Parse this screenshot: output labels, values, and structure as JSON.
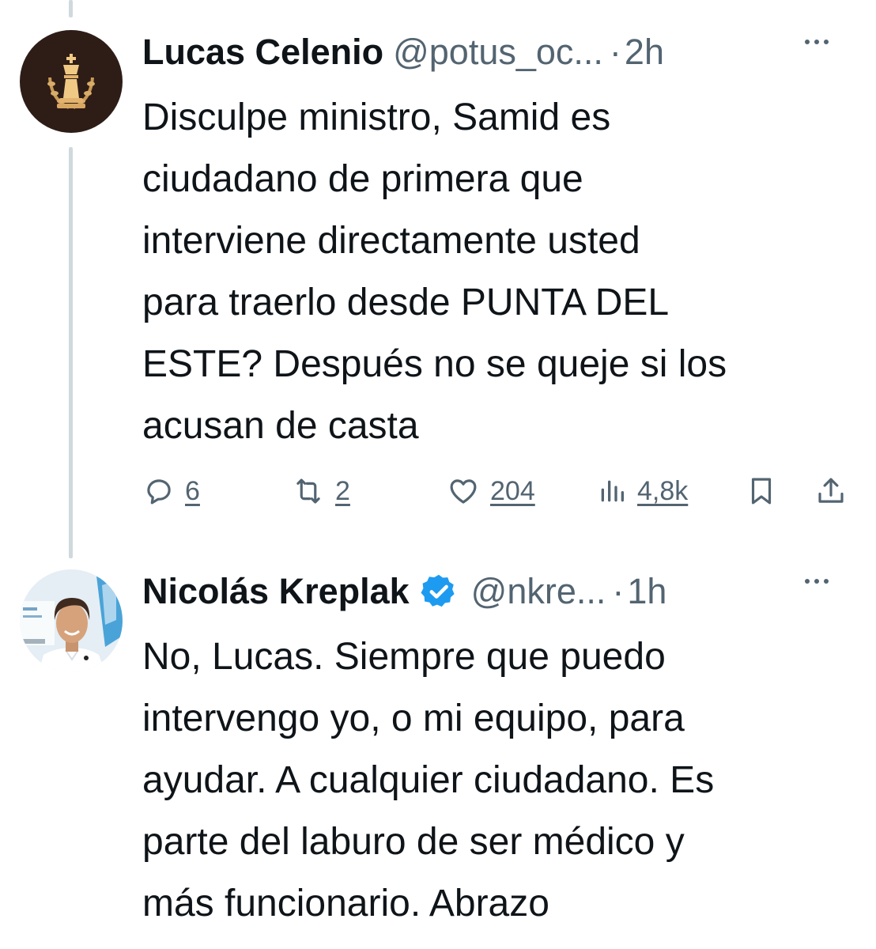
{
  "tweets": [
    {
      "display_name": "Lucas Celenio",
      "handle": "@potus_oc...",
      "separator": "·",
      "time": "2h",
      "text_lines": [
        "Disculpe ministro, Samid es",
        "ciudadano de primera que",
        "interviene directamente usted",
        "para traerlo desde PUNTA DEL",
        "ESTE? Después no se queje si los",
        "acusan de casta"
      ],
      "verified": false,
      "avatar_icon": "chess-king-avatar",
      "actions": {
        "replies": "6",
        "retweets": "2",
        "likes": "204",
        "views": "4,8k"
      }
    },
    {
      "display_name": "Nicolás Kreplak",
      "handle": "@nkre...",
      "separator": "·",
      "time": "1h",
      "text_lines": [
        "No, Lucas. Siempre que puedo",
        "intervengo yo, o mi equipo, para",
        "ayudar. A cualquier ciudadano. Es",
        "parte del laburo de ser médico y",
        "más funcionario. Abrazo"
      ],
      "verified": true,
      "avatar_icon": "person-photo-avatar"
    }
  ],
  "icons": {
    "reply": "reply-icon",
    "retweet": "retweet-icon",
    "like": "heart-icon",
    "views": "views-icon",
    "bookmark": "bookmark-icon",
    "share": "share-icon",
    "more": "more-icon",
    "verified": "verified-badge-icon"
  },
  "colors": {
    "text": "#0f1419",
    "secondary": "#536471",
    "thread_line": "#cfd9de",
    "verified": "#1d9bf0"
  }
}
